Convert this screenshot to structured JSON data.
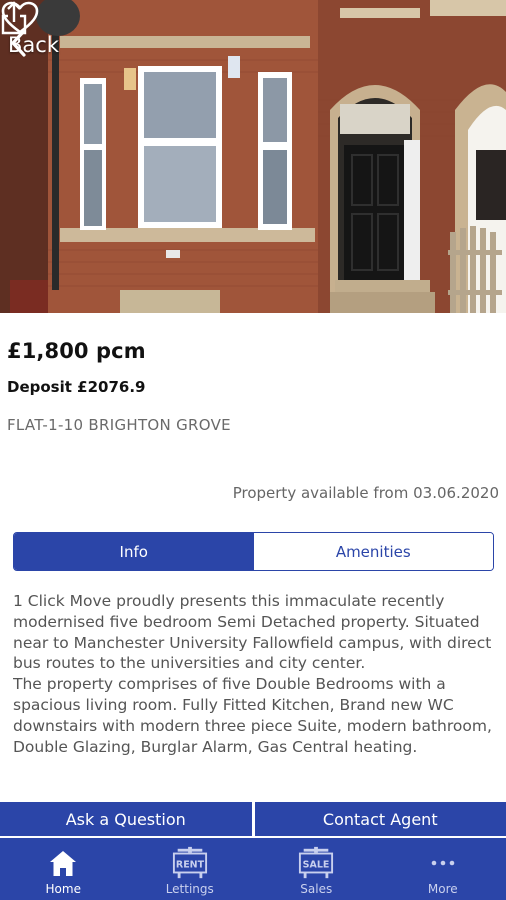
{
  "header": {
    "back_label": "Back"
  },
  "listing": {
    "price": "£1,800 pcm",
    "deposit": "Deposit £2076.9",
    "address": "FLAT-1-10 BRIGHTON GROVE",
    "available": "Property available from 03.06.2020"
  },
  "tabs": {
    "info": "Info",
    "amenities": "Amenities",
    "active": "Info"
  },
  "description": {
    "paragraph1": "1 Click Move proudly presents this immaculate recently modernised five bedroom Semi Detached property. Situated near to Manchester University Fallowfield campus, with direct bus routes to the universities and city center.",
    "paragraph2": "The property comprises of five Double Bedrooms with a spacious living room. Fully Fitted Kitchen, Brand new WC downstairs with modern three piece Suite, modern bathroom, Double Glazing, Burglar Alarm, Gas Central heating."
  },
  "actions": {
    "ask": "Ask a Question",
    "contact": "Contact Agent"
  },
  "nav": {
    "items": [
      {
        "label": "Home",
        "icon": "home-icon",
        "active": true
      },
      {
        "label": "Lettings",
        "icon": "rent-sign-icon",
        "badge": "RENT",
        "active": false
      },
      {
        "label": "Sales",
        "icon": "sale-sign-icon",
        "badge": "SALE",
        "active": false
      },
      {
        "label": "More",
        "icon": "more-dots-icon",
        "active": false
      }
    ]
  },
  "colors": {
    "brand": "#2b45a8",
    "brick": "#9a4e34"
  }
}
